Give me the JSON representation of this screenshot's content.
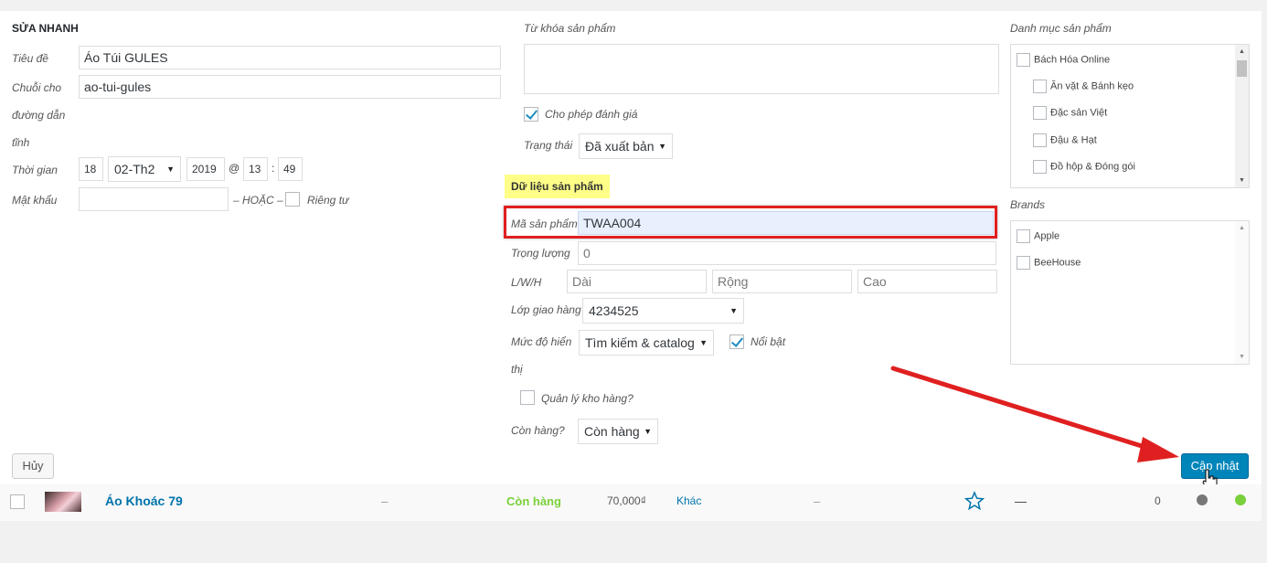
{
  "edit": {
    "section_title": "SỬA NHANH",
    "title_label": "Tiêu đề",
    "title_value": "Áo Túi GULES",
    "slug_label_1": "Chuỗi cho",
    "slug_label_2": "đường dẫn",
    "slug_label_3": "tĩnh",
    "slug_value": "ao-tui-gules",
    "date_label": "Thời gian",
    "day": "18",
    "month": "02-Th2",
    "year": "2019",
    "at": "@",
    "hour": "13",
    "colon": ":",
    "minute": "49",
    "password_label": "Mật khẩu",
    "or_text": "– HOẶC –",
    "private_label": "Riêng tư"
  },
  "middle": {
    "tags_label": "Từ khóa sản phẩm",
    "allow_reviews_label": "Cho phép đánh giá",
    "status_label": "Trạng thái",
    "status_value": "Đã xuất bản",
    "product_data_title": "Dữ liệu sản phẩm",
    "sku_label": "Mã sản phẩm",
    "sku_value": "TWAA004",
    "weight_label": "Trọng lượng",
    "weight_placeholder": "0",
    "lwh_label": "L/W/H",
    "length_placeholder": "Dài",
    "width_placeholder": "Rộng",
    "height_placeholder": "Cao",
    "shipping_class_label": "Lớp giao hàng",
    "shipping_class_value": "4234525",
    "visibility_label_1": "Mức độ hiển",
    "visibility_label_2": "thị",
    "visibility_value": "Tìm kiếm & catalog",
    "featured_label": "Nổi bật",
    "manage_stock_label": "Quản lý kho hàng?",
    "in_stock_label": "Còn hàng?",
    "in_stock_value": "Còn hàng"
  },
  "right": {
    "categories_label": "Danh mục sản phẩm",
    "categories": [
      "Bách Hóa Online",
      "Ăn vặt & Bánh kẹo",
      "Đặc sản Việt",
      "Đậu & Hạt",
      "Đồ hộp & Đóng gói"
    ],
    "brands_label": "Brands",
    "brands": [
      "Apple",
      "BeeHouse"
    ]
  },
  "buttons": {
    "cancel": "Hủy",
    "update": "Cập nhật"
  },
  "row": {
    "name": "Áo Khoác 79",
    "sku": "–",
    "stock": "Còn hàng",
    "price": "70,000₫",
    "category": "Khác",
    "tags": "–",
    "type": "—",
    "count": "0"
  },
  "colors": {
    "link": "#0073aa",
    "in_stock": "#7ad03a",
    "primary_button": "#0085ba",
    "highlight": "#ffff88",
    "annotation_red": "#e02020"
  }
}
